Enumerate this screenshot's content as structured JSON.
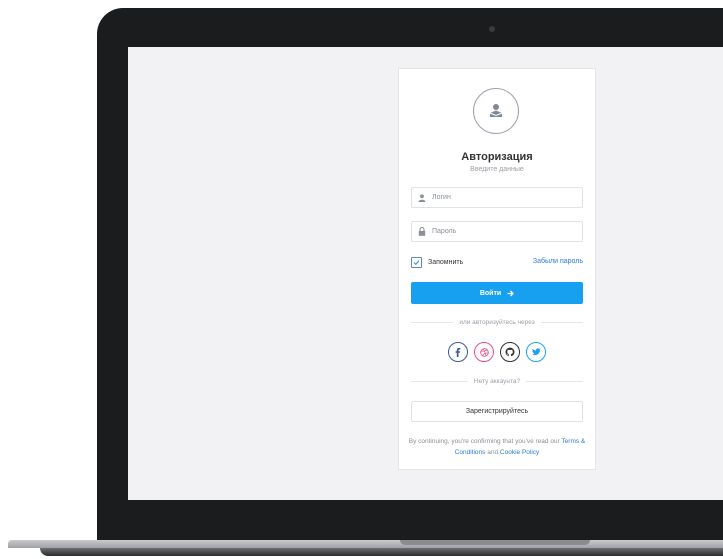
{
  "auth": {
    "title": "Авторизация",
    "subtitle": "Введите данные",
    "login_placeholder": "Логин",
    "password_placeholder": "Пароль",
    "remember_label": "Запомнить",
    "forgot_label": "Забыли пароль",
    "submit_label": "Войти",
    "social_divider": "или авторизуйтесь через",
    "no_account_divider": "Нету аккаунта?",
    "register_label": "Зарегистрируйтесь",
    "terms_prefix": "By continuing, you're confirming that you've read our",
    "terms_link": "Terms & Conditions",
    "terms_and": "and",
    "cookie_link": "Cookie Policy"
  },
  "socials": [
    {
      "icon": "facebook-icon",
      "color": "#3b5998"
    },
    {
      "icon": "dribbble-icon",
      "color": "#ea4c89"
    },
    {
      "icon": "github-icon",
      "color": "#333333"
    },
    {
      "icon": "twitter-icon",
      "color": "#1da1f2"
    }
  ],
  "colors": {
    "accent": "#16a0ef",
    "link": "#2a7bd6"
  },
  "remember_checked": true
}
